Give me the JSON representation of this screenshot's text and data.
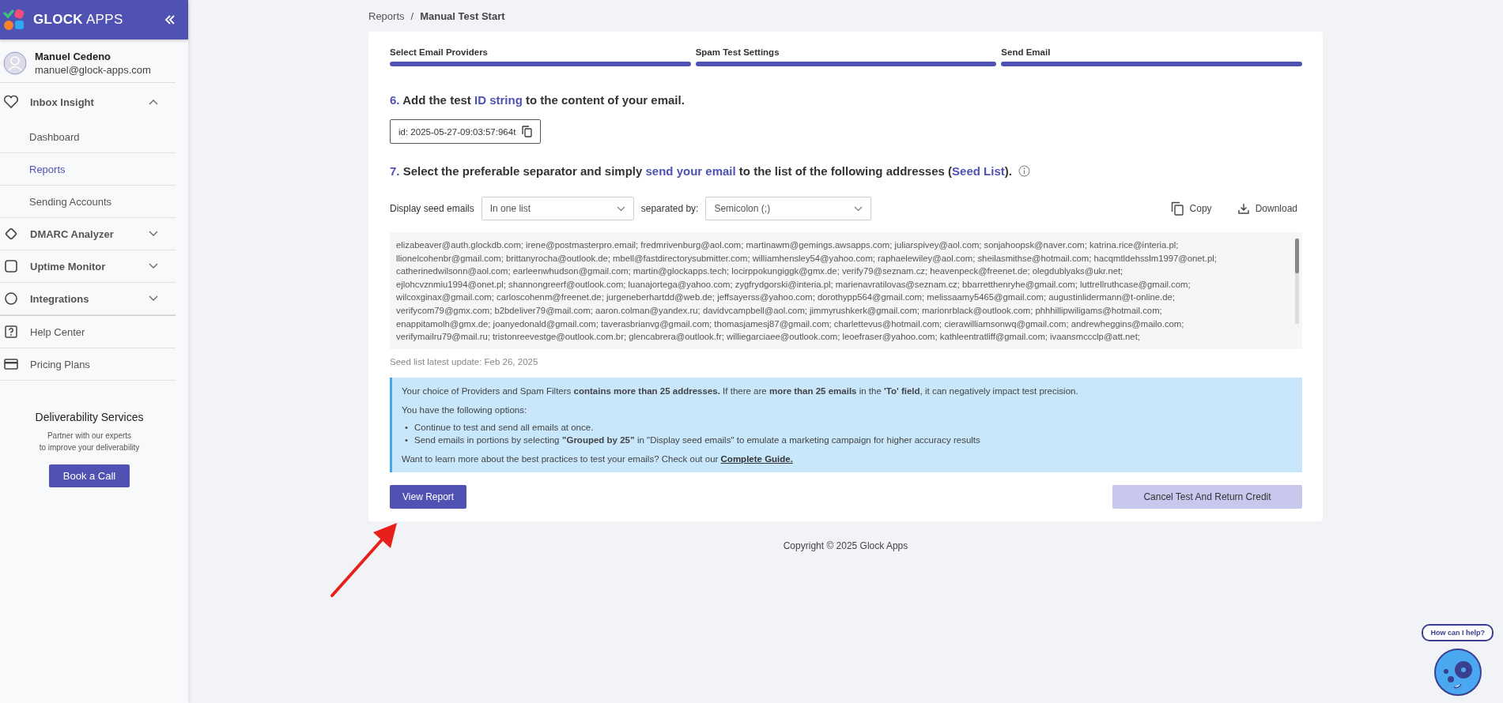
{
  "sidebar": {
    "brand": {
      "bold": "GLOCK",
      "light": "APPS"
    },
    "user": {
      "name": "Manuel Cedeno",
      "email": "manuel@glock-apps.com"
    },
    "nav": [
      {
        "kind": "group",
        "label": "Inbox Insight",
        "expanded": true,
        "children": [
          {
            "label": "Dashboard",
            "selected": false
          },
          {
            "label": "Reports",
            "selected": true
          },
          {
            "label": "Sending Accounts",
            "selected": false
          }
        ]
      },
      {
        "kind": "group",
        "label": "DMARC Analyzer",
        "expanded": false
      },
      {
        "kind": "group",
        "label": "Uptime Monitor",
        "expanded": false
      },
      {
        "kind": "group",
        "label": "Integrations",
        "expanded": false
      },
      {
        "kind": "link",
        "label": "Help Center"
      },
      {
        "kind": "link",
        "label": "Pricing Plans"
      }
    ],
    "promo": {
      "title": "Deliverability Services",
      "lines": [
        "Partner with our experts",
        "to improve your deliverability"
      ],
      "button": "Book a Call"
    }
  },
  "breadcrumb": [
    {
      "label": "Reports",
      "current": false
    },
    {
      "label": "Manual Test Start",
      "current": true
    }
  ],
  "breadcrumb_separator": "/",
  "steps": [
    {
      "label": "Select Email Providers",
      "completed": true
    },
    {
      "label": "Spam Test Settings",
      "completed": true
    },
    {
      "label": "Send Email",
      "completed": true
    }
  ],
  "step6": {
    "number": "6.",
    "parts": [
      {
        "text": "Add the test ",
        "highlight": false
      },
      {
        "text": "ID string",
        "highlight": true
      },
      {
        "text": " to the content of your email.",
        "highlight": false
      }
    ],
    "id_value": "id: 2025-05-27-09:03:57:964t"
  },
  "step7": {
    "number": "7.",
    "parts": [
      {
        "text": "Select the preferable separator and simply ",
        "highlight": false
      },
      {
        "text": "send your email",
        "highlight": true
      },
      {
        "text": " to the list of the following addresses (",
        "highlight": false
      },
      {
        "text": "Seed List",
        "highlight": true
      },
      {
        "text": ").",
        "highlight": false
      }
    ]
  },
  "controls": {
    "display_label": "Display seed emails",
    "display_value": "In one list",
    "separator_label": "separated by:",
    "separator_value": "Semicolon (;)",
    "copy": "Copy",
    "download": "Download"
  },
  "seed_lines": [
    "elizabeaver@auth.glockdb.com; irene@postmasterpro.email; fredmrivenburg@aol.com; martinawm@gemings.awsapps.com; juliarspivey@aol.com; sonjahoopsk@naver.com; katrina.rice@interia.pl;",
    "llionelcohenbr@gmail.com; brittanyrocha@outlook.de; mbell@fastdirectorysubmitter.com; williamhensley54@yahoo.com; raphaelewiley@aol.com; sheilasmithse@hotmail.com; hacqmtldehsslm1997@onet.pl;",
    "catherinedwilsonn@aol.com; earleenwhudson@gmail.com; martin@glockapps.tech; locirppokungiggk@gmx.de; verify79@seznam.cz; heavenpeck@freenet.de; olegdublyaks@ukr.net;",
    "ejlohcvznmiu1994@onet.pl; shannongreerf@outlook.com; luanajortega@yahoo.com; zygfrydgorski@interia.pl; marienavratilovas@seznam.cz; bbarretthenryhe@gmail.com; luttrellruthcase@gmail.com;",
    "wilcoxginax@gmail.com; carloscohenm@freenet.de; jurgeneberhartdd@web.de; jeffsayerss@yahoo.com; dorothypp564@gmail.com; melissaamy5465@gmail.com; augustinlidermann@t-online.de;",
    "verifycom79@gmx.com; b2bdeliver79@mail.com; aaron.colman@yandex.ru; davidvcampbell@aol.com; jimmyrushkerk@gmail.com; marionrblack@outlook.com; phhhillipwiligams@hotmail.com;",
    "enappitamolh@gmx.de; joanyedonald@gmail.com; taverasbrianvg@gmail.com; thomasjamesj87@gmail.com; charlettevus@hotmail.com; cierawilliamsonwq@gmail.com; andrewheggins@mailo.com;",
    "verifymailru79@mail.ru; tristonreevestge@outlook.com.br; glencabrera@outlook.fr; williegarciaee@outlook.com; leoefraser@yahoo.com; kathleentratliff@gmail.com; ivaansmccclp@att.net;"
  ],
  "seed_update": "Seed list latest update: Feb 26, 2025",
  "notice": {
    "warning": "Your choice of Providers and Spam Filters **contains more than 25 addresses.** If there are **more than 25 emails** in the **'To' field**, it can negatively impact test precision.",
    "options_intro": "You have the following options:",
    "bullet": "•",
    "options": [
      "Continue to test and send all emails at once.",
      "Send emails in portions by selecting **”Grouped by 25”** in \"Display seed emails\" to emulate a marketing campaign for higher accuracy results"
    ],
    "learn_more": "Want to learn more about the best practices to test your emails? Check out our",
    "link": "Complete Guide."
  },
  "actions": {
    "primary": "View Report",
    "secondary": "Cancel Test And Return Credit"
  },
  "footer": "Copyright © 2025 Glock Apps",
  "chat": {
    "bubble": "How can I help?"
  }
}
